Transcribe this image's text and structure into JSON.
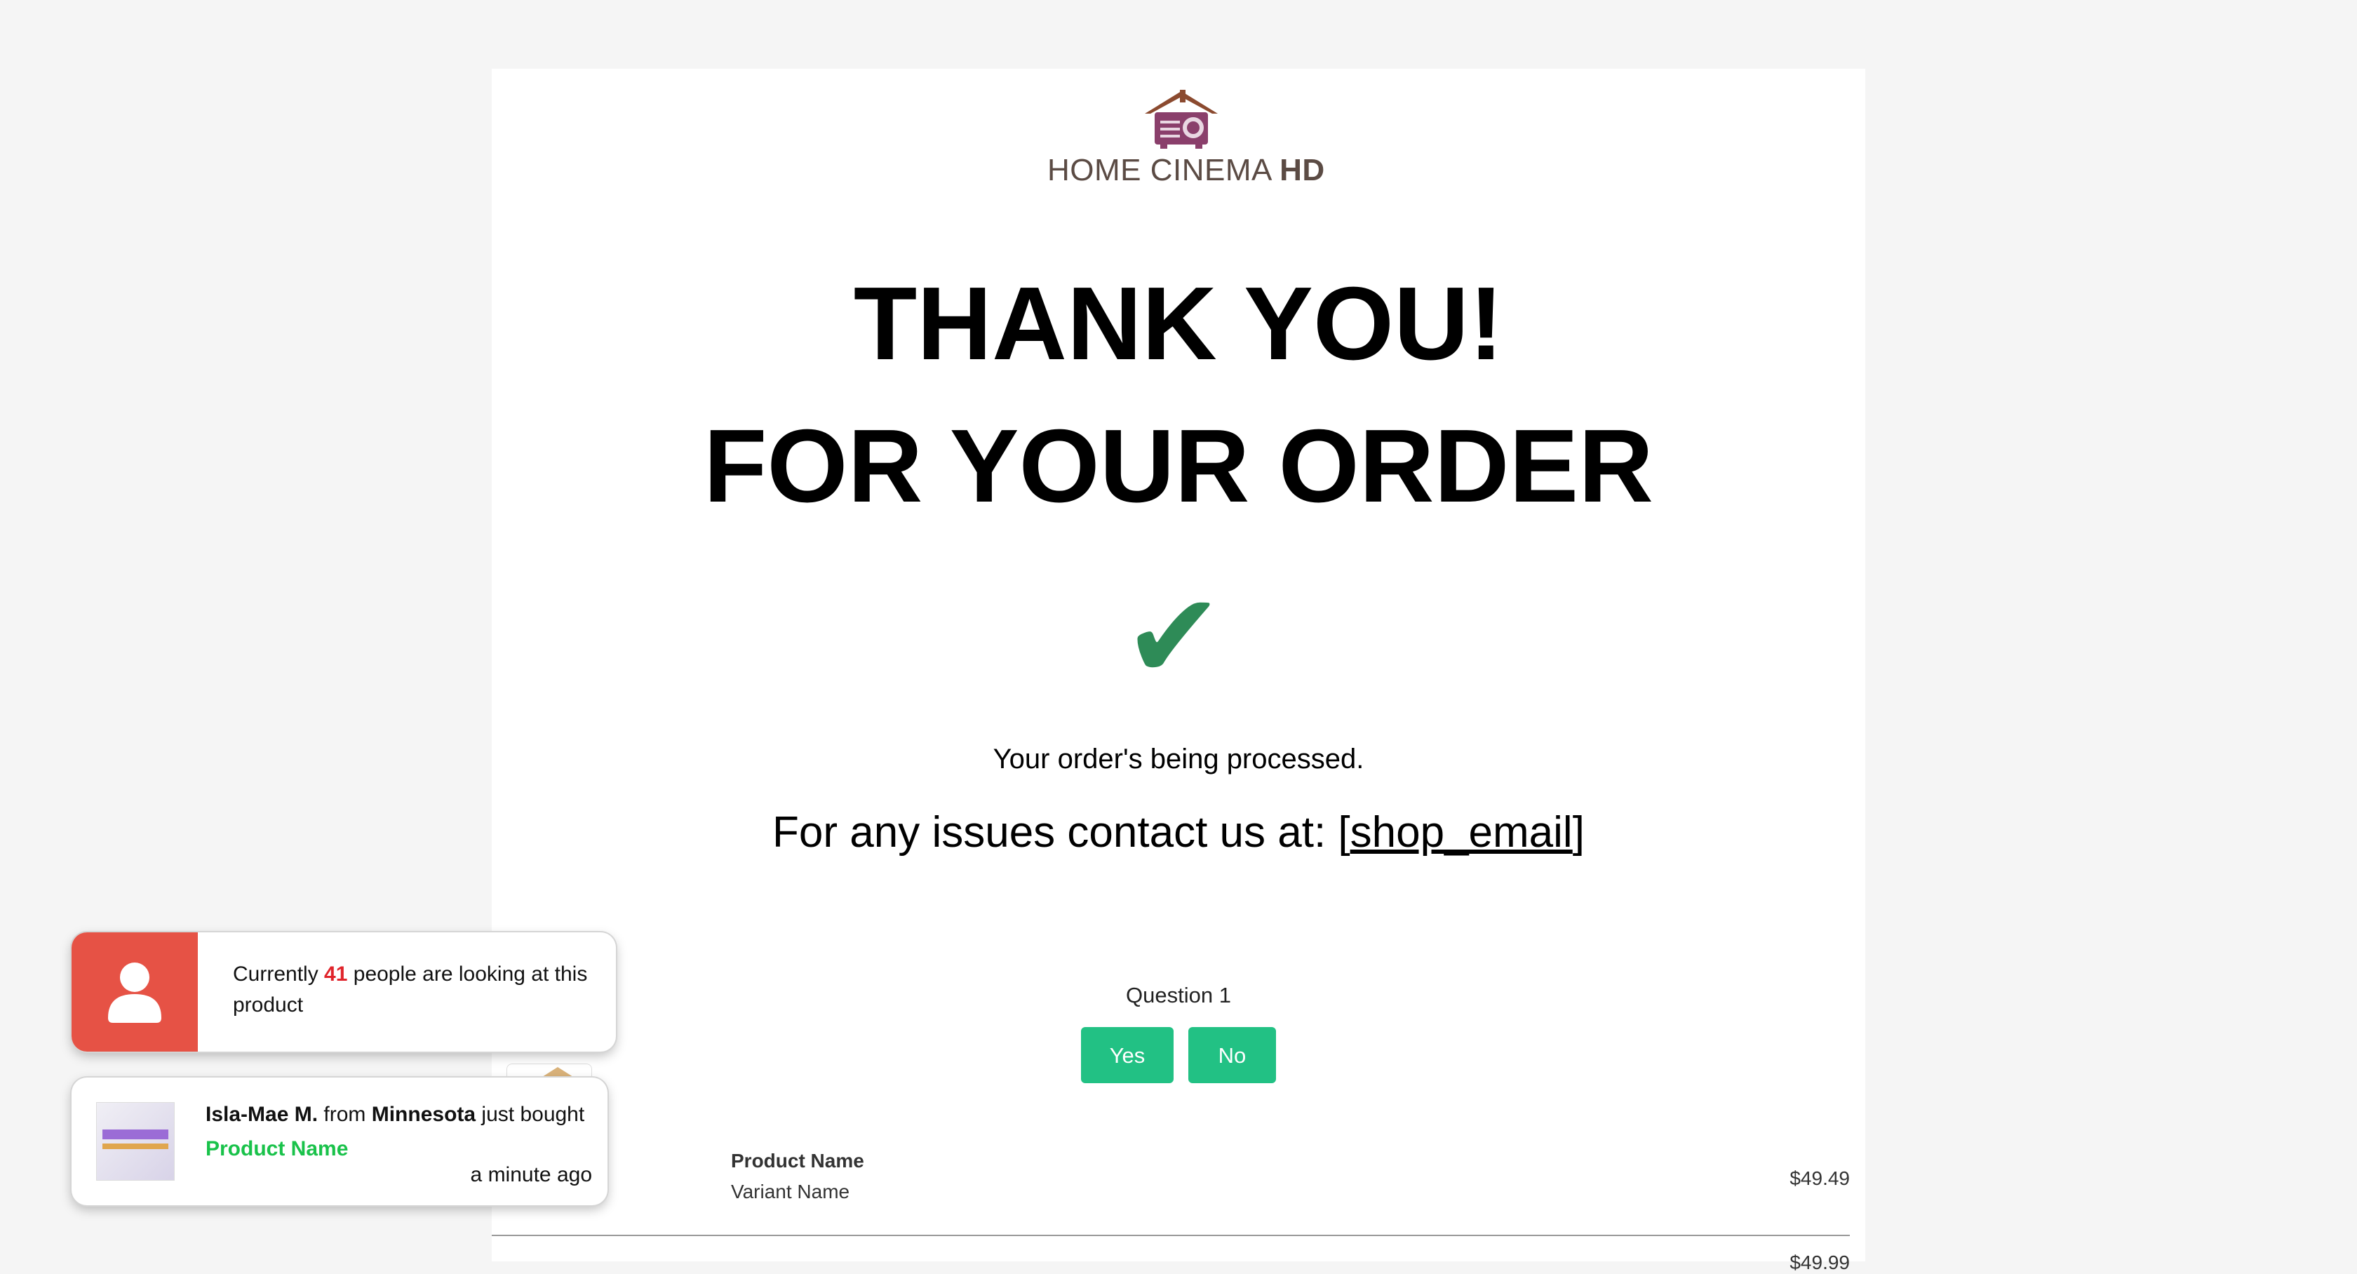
{
  "brand": {
    "name_regular": "HOME CINEMA",
    "name_bold": "HD",
    "logo_icon": "house-projector-icon",
    "colors": {
      "roof": "#8b4a2f",
      "projector": "#8a3f6b",
      "text": "#5b4b44"
    }
  },
  "hero": {
    "line1": "THANK YOU!",
    "line2": "FOR YOUR ORDER",
    "check_icon": "checkmark-icon",
    "check_color": "#2e8b57",
    "processing_text": "Your order's being processed.",
    "contact_prefix": "For any issues contact us at: [",
    "contact_link": "shop_email",
    "contact_suffix": "]"
  },
  "survey": {
    "question": "Question 1",
    "yes_label": "Yes",
    "no_label": "No",
    "button_color": "#22c184"
  },
  "order_items": [
    {
      "name": "Product Name",
      "variant": "Variant Name",
      "price": "$49.49"
    },
    {
      "price": "$49.99"
    }
  ],
  "viewers_popup": {
    "prefix": "Currently ",
    "count": "41",
    "suffix": " people are looking at this product",
    "icon": "user-icon",
    "accent": "#e65245"
  },
  "purchase_popup": {
    "buyer": "Isla-Mae M.",
    "from_text": " from ",
    "location": "Minnesota",
    "action": " just bought",
    "product": "Product Name",
    "time": "a minute ago",
    "thumbnail": "product-thumbnail"
  }
}
